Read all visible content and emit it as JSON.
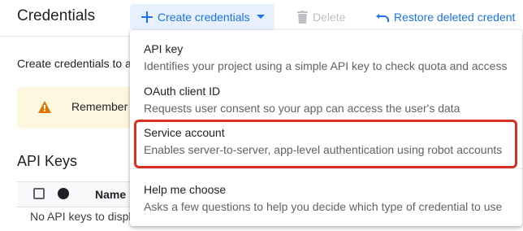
{
  "header": {
    "title": "Credentials",
    "create_label": "Create credentials",
    "delete_label": "Delete",
    "restore_label": "Restore deleted credent"
  },
  "main": {
    "intro": "Create credentials to access your enabled APIs",
    "banner_text": "Remember t",
    "section_title": "API Keys",
    "table": {
      "col_name": "Name",
      "empty_text": "No API keys to display"
    }
  },
  "menu": {
    "items": [
      {
        "title": "API key",
        "description": "Identifies your project using a simple API key to check quota and access"
      },
      {
        "title": "OAuth client ID",
        "description": "Requests user consent so your app can access the user's data"
      },
      {
        "title": "Service account",
        "description": "Enables server-to-server, app-level authentication using robot accounts"
      },
      {
        "title": "Help me choose",
        "description": "Asks a few questions to help you decide which type of credential to use"
      }
    ]
  },
  "icons": {
    "create": "plus-icon",
    "caret": "caret-down-icon",
    "delete": "trash-icon",
    "restore": "undo-icon",
    "warning": "warning-icon"
  },
  "colors": {
    "accent": "#1a73e8",
    "highlight": "#d93025",
    "warning": "#e37400",
    "banner_bg": "#fef7e0"
  }
}
